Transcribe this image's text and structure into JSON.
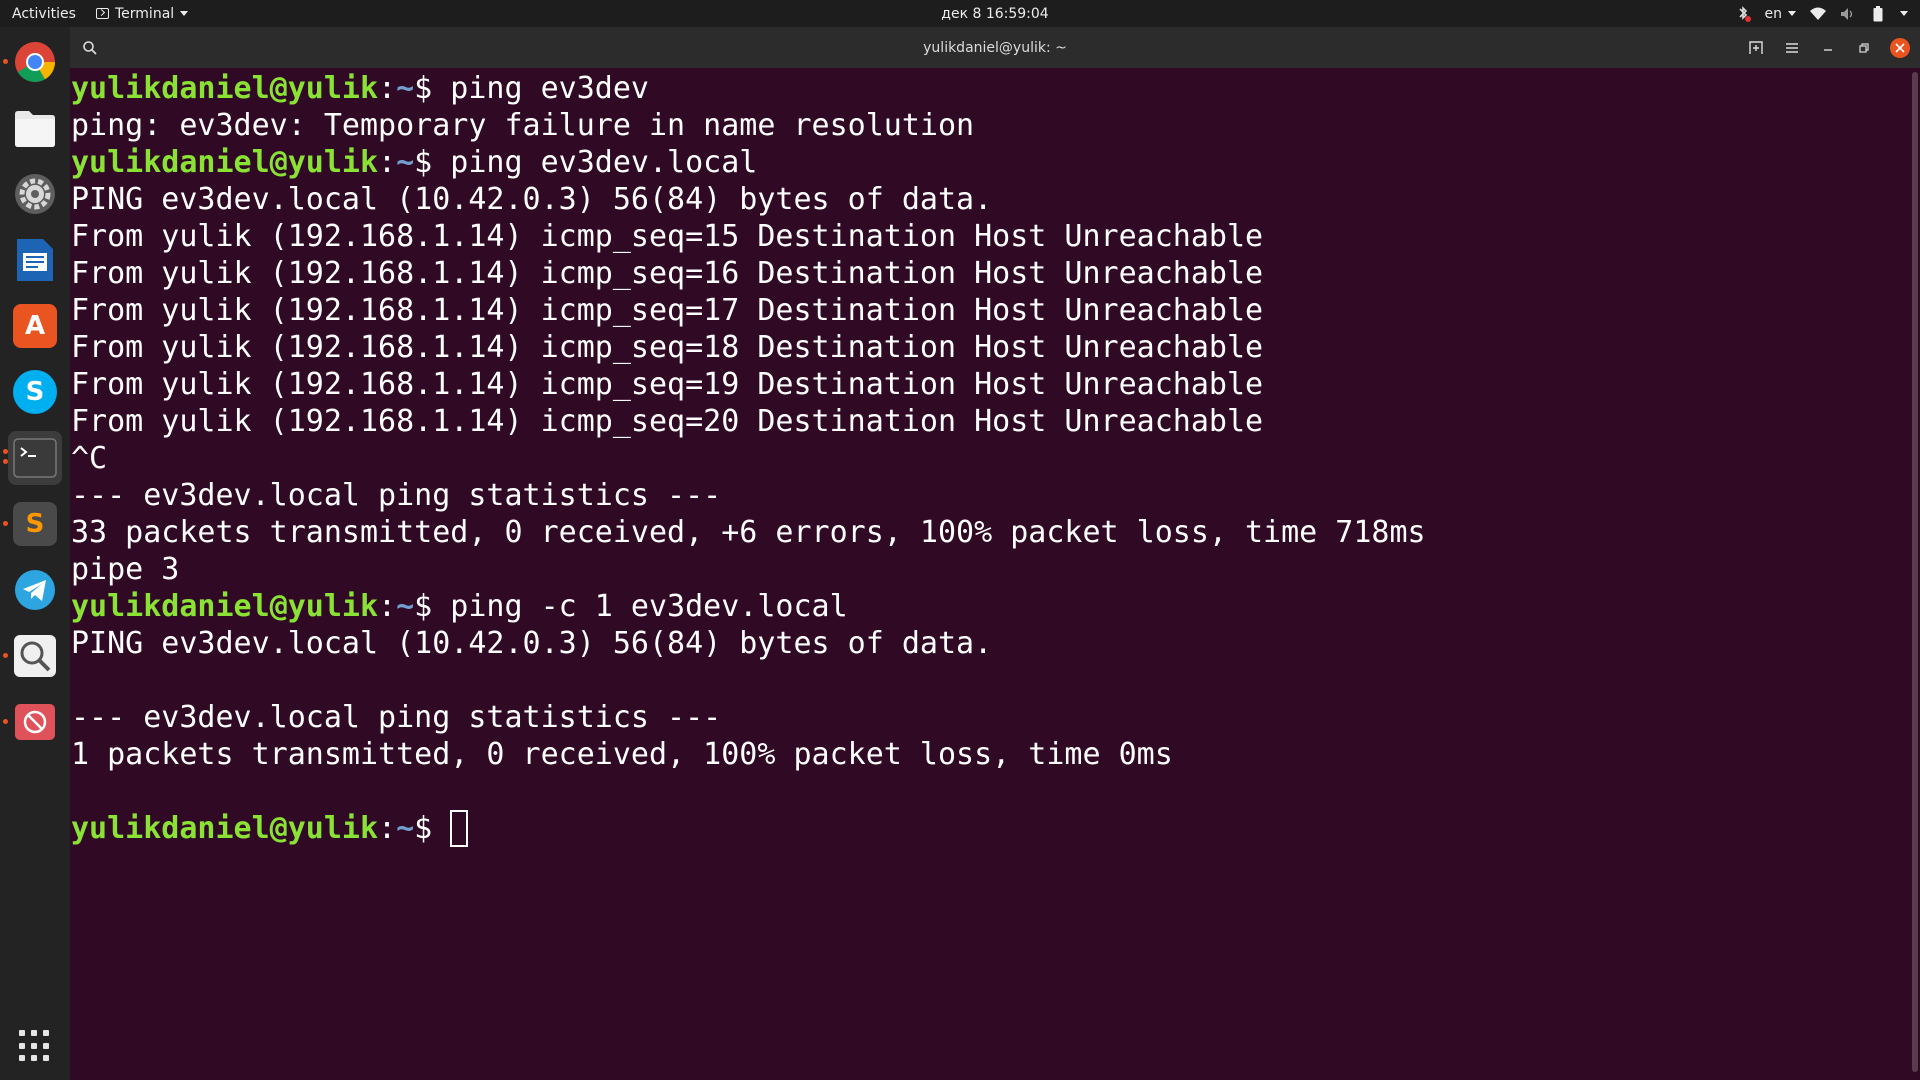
{
  "topbar": {
    "activities": "Activities",
    "app_name": "Terminal",
    "clock": "дек 8  16:59:04",
    "language": "en"
  },
  "window": {
    "title": "yulikdaniel@yulik: ~"
  },
  "terminal": {
    "prompt_user": "yulikdaniel@yulik",
    "prompt_path": "~",
    "lines": [
      {
        "type": "prompt",
        "cmd": "ping ev3dev"
      },
      {
        "type": "out",
        "text": "ping: ev3dev: Temporary failure in name resolution"
      },
      {
        "type": "prompt",
        "cmd": "ping ev3dev.local"
      },
      {
        "type": "out",
        "text": "PING ev3dev.local (10.42.0.3) 56(84) bytes of data."
      },
      {
        "type": "out",
        "text": "From yulik (192.168.1.14) icmp_seq=15 Destination Host Unreachable"
      },
      {
        "type": "out",
        "text": "From yulik (192.168.1.14) icmp_seq=16 Destination Host Unreachable"
      },
      {
        "type": "out",
        "text": "From yulik (192.168.1.14) icmp_seq=17 Destination Host Unreachable"
      },
      {
        "type": "out",
        "text": "From yulik (192.168.1.14) icmp_seq=18 Destination Host Unreachable"
      },
      {
        "type": "out",
        "text": "From yulik (192.168.1.14) icmp_seq=19 Destination Host Unreachable"
      },
      {
        "type": "out",
        "text": "From yulik (192.168.1.14) icmp_seq=20 Destination Host Unreachable"
      },
      {
        "type": "out",
        "text": "^C"
      },
      {
        "type": "out",
        "text": "--- ev3dev.local ping statistics ---"
      },
      {
        "type": "out",
        "text": "33 packets transmitted, 0 received, +6 errors, 100% packet loss, time 718ms"
      },
      {
        "type": "out",
        "text": "pipe 3"
      },
      {
        "type": "prompt",
        "cmd": "ping -c 1 ev3dev.local"
      },
      {
        "type": "out",
        "text": "PING ev3dev.local (10.42.0.3) 56(84) bytes of data."
      },
      {
        "type": "out",
        "text": ""
      },
      {
        "type": "out",
        "text": "--- ev3dev.local ping statistics ---"
      },
      {
        "type": "out",
        "text": "1 packets transmitted, 0 received, 100% packet loss, time 0ms"
      },
      {
        "type": "out",
        "text": ""
      },
      {
        "type": "prompt",
        "cmd": "",
        "cursor": true
      }
    ]
  },
  "dock": {
    "apps": [
      {
        "name": "chrome",
        "icon": "chrome-icon",
        "running": true
      },
      {
        "name": "files",
        "icon": "folder-icon",
        "running": false
      },
      {
        "name": "settings",
        "icon": "gear-icon",
        "running": false
      },
      {
        "name": "writer",
        "icon": "document-icon",
        "running": false
      },
      {
        "name": "software",
        "icon": "app-store-icon",
        "running": false
      },
      {
        "name": "skype",
        "icon": "skype-icon",
        "running": false
      },
      {
        "name": "terminal",
        "icon": "terminal-icon",
        "running": true
      },
      {
        "name": "sublime",
        "icon": "sublime-icon",
        "running": true
      },
      {
        "name": "telegram",
        "icon": "telegram-icon",
        "running": false
      },
      {
        "name": "search",
        "icon": "magnifier-icon",
        "running": true
      },
      {
        "name": "blocked",
        "icon": "no-entry-icon",
        "running": true
      }
    ]
  },
  "colors": {
    "terminal_bg": "#300a24",
    "prompt_user": "#8ae234",
    "prompt_path": "#729fcf",
    "accent": "#e95420"
  }
}
